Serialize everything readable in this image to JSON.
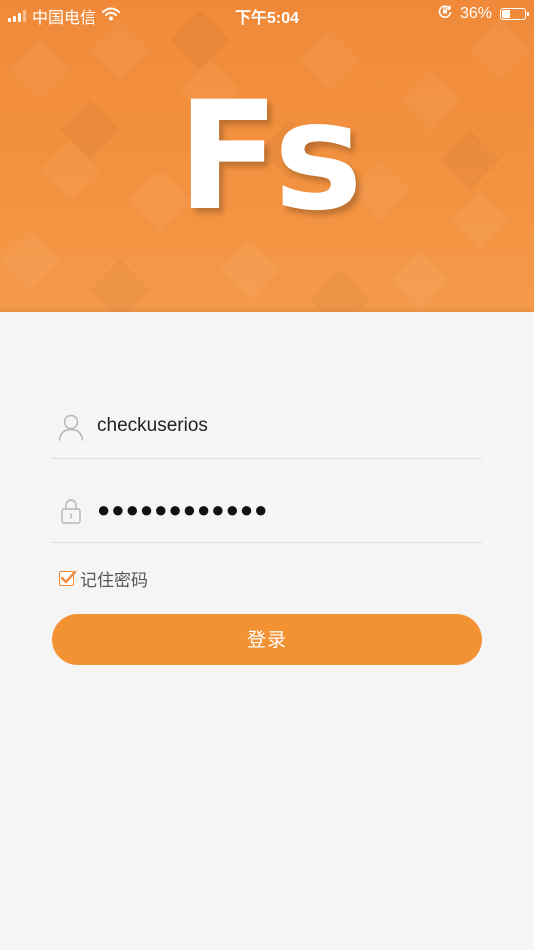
{
  "status_bar": {
    "carrier": "中国电信",
    "time": "下午5:04",
    "battery_percent_label": "36%",
    "battery_level": 0.36,
    "icons": [
      "signal-icon",
      "wifi-icon",
      "orientation-lock-icon",
      "battery-icon"
    ]
  },
  "header": {
    "logo_text": "Fs",
    "background_color": "#f39240"
  },
  "login_form": {
    "username_value": "checkuserios",
    "password_masked": "●●●●●●●●●●●●",
    "remember_label": "记住密码",
    "remember_checked": true,
    "login_label": "登录",
    "icons": [
      "user-icon",
      "lock-icon"
    ]
  },
  "colors": {
    "accent": "#f39233",
    "background": "#f5f5f5",
    "divider": "#dedede"
  }
}
